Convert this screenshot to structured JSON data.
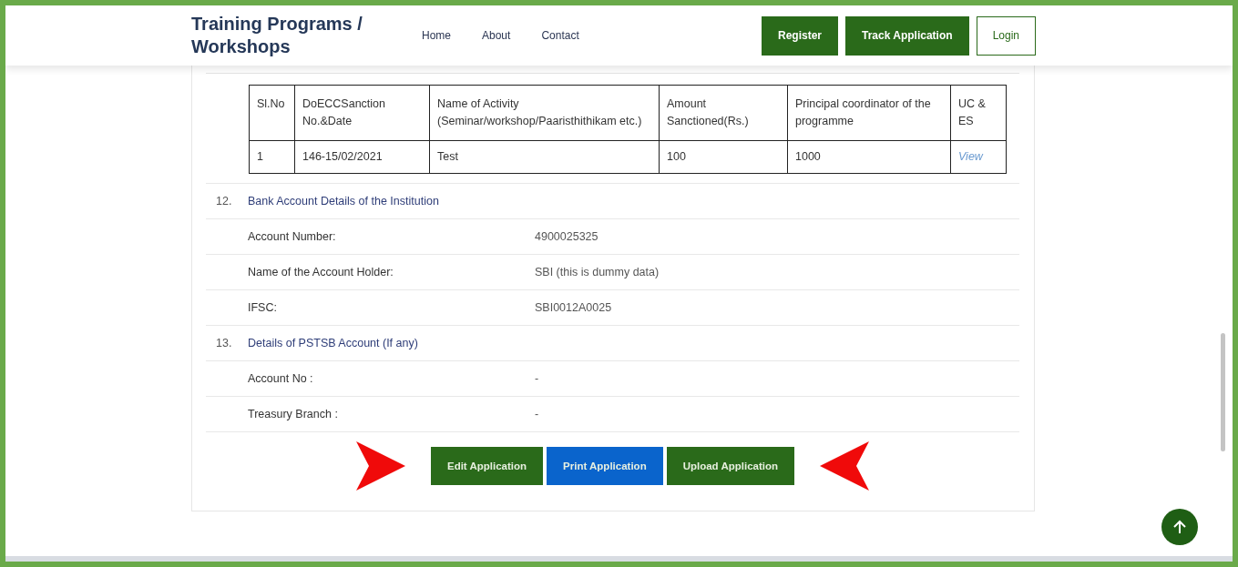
{
  "header": {
    "title": "Training Programs / Workshops",
    "nav": [
      "Home",
      "About",
      "Contact"
    ],
    "buttons": [
      {
        "label": "Register",
        "kind": "filled"
      },
      {
        "label": "Track Application",
        "kind": "filled"
      },
      {
        "label": "Login",
        "kind": "outline"
      }
    ]
  },
  "table": {
    "columns": [
      "Sl.No",
      "DoECCSanction No.&Date",
      "Name of Activity (Seminar/workshop/Paaristhithikam etc.)",
      "Amount Sanctioned(Rs.)",
      "Principal coordinator of the programme",
      "UC & ES"
    ],
    "rows": [
      [
        "1",
        "146-15/02/2021",
        "Test",
        "100",
        "1000",
        "View"
      ]
    ]
  },
  "sections": [
    {
      "number": "12.",
      "title": "Bank Account Details of the Institution",
      "fields": [
        {
          "label": "Account Number:",
          "value": "4900025325"
        },
        {
          "label": "Name of the Account Holder:",
          "value": "SBI (this is dummy data)"
        },
        {
          "label": "IFSC:",
          "value": "SBI0012A0025"
        }
      ]
    },
    {
      "number": "13.",
      "title": "Details of PSTSB Account (If any)",
      "fields": [
        {
          "label": "Account No :",
          "value": "-"
        },
        {
          "label": "Treasury Branch :",
          "value": "-"
        }
      ]
    }
  ],
  "actions": [
    {
      "label": "Edit Application",
      "kind": "green"
    },
    {
      "label": "Print Application",
      "kind": "blue"
    },
    {
      "label": "Upload Application",
      "kind": "green"
    }
  ]
}
